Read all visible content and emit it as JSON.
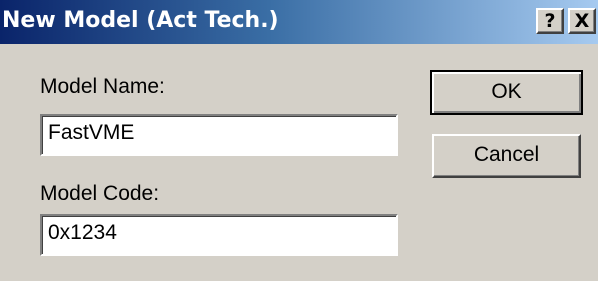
{
  "window": {
    "title": "New Model (Act Tech.)",
    "help_label": "?",
    "close_label": "X"
  },
  "form": {
    "model_name_label": "Model Name:",
    "model_name_value": "FastVME",
    "model_code_label": "Model Code:",
    "model_code_value": "0x1234"
  },
  "buttons": {
    "ok_label": "OK",
    "cancel_label": "Cancel"
  },
  "colors": {
    "title_bar_start": "#0a246a",
    "title_bar_end": "#a6caf0",
    "dialog_face": "#d4d0c8"
  }
}
